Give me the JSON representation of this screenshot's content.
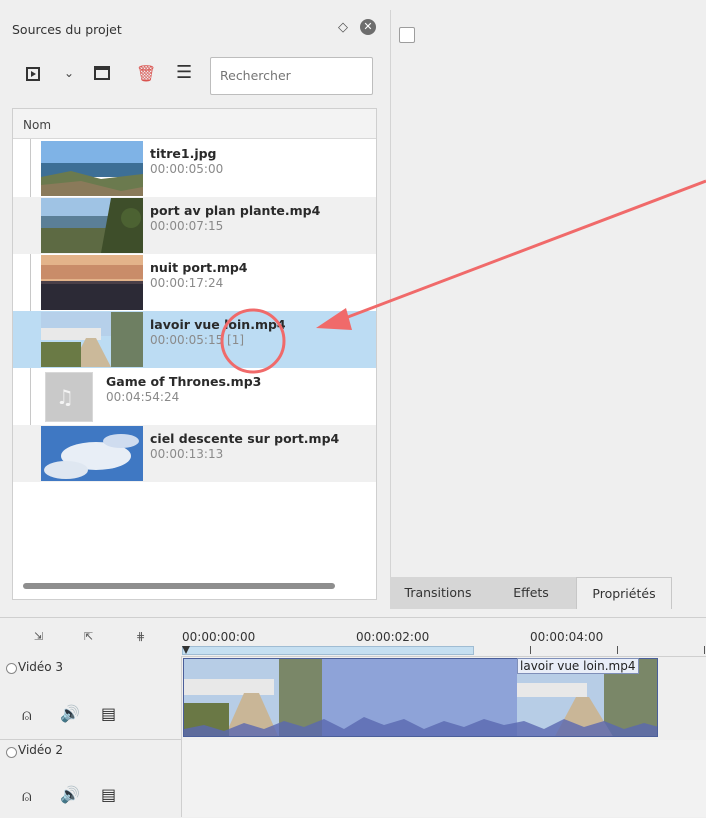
{
  "project_bin": {
    "title": "Sources du projet",
    "search_placeholder": "Rechercher",
    "column_header": "Nom",
    "items": [
      {
        "name": "titre1.jpg",
        "duration": "00:00:05:00",
        "thumb": "landscape-sea"
      },
      {
        "name": "port av plan plante.mp4",
        "duration": "00:00:07:15",
        "thumb": "port-plants"
      },
      {
        "name": "nuit port.mp4",
        "duration": "00:00:17:24",
        "thumb": "sunset-port"
      },
      {
        "name": "lavoir vue loin.mp4",
        "duration": "00:00:05:15 [1]",
        "thumb": "path-houses",
        "selected": true
      },
      {
        "name": "Game of Thrones.mp3",
        "duration": "00:04:54:24",
        "thumb": "audio-note"
      },
      {
        "name": "ciel descente sur port.mp4",
        "duration": "00:00:13:13",
        "thumb": "sky-clouds"
      }
    ]
  },
  "right_panel": {
    "tabs": [
      "Transitions",
      "Effets",
      "Propriétés"
    ],
    "active_tab": "Propriétés"
  },
  "timeline": {
    "ruler_times": [
      "00:00:00:00",
      "00:00:02:00",
      "00:00:04:00"
    ],
    "tracks": [
      {
        "name": "Vidéo 3"
      },
      {
        "name": "Vidéo 2"
      }
    ],
    "clip_label": "lavoir vue loin.mp4"
  },
  "annotation": {
    "color": "#f06a6a"
  }
}
